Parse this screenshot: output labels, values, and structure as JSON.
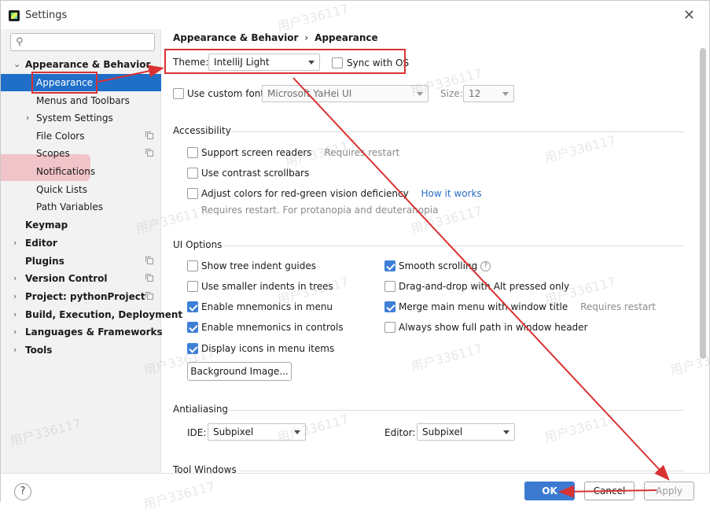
{
  "window": {
    "title": "Settings",
    "close_glyph": "✕"
  },
  "sidebar": {
    "search": {
      "placeholder": "",
      "value": ""
    },
    "items": [
      {
        "label": "Appearance & Behavior",
        "expanded": true
      },
      {
        "label": "Appearance",
        "selected": true
      },
      {
        "label": "Menus and Toolbars"
      },
      {
        "label": "System Settings"
      },
      {
        "label": "File Colors"
      },
      {
        "label": "Scopes"
      },
      {
        "label": "Notifications"
      },
      {
        "label": "Quick Lists"
      },
      {
        "label": "Path Variables"
      },
      {
        "label": "Keymap"
      },
      {
        "label": "Editor"
      },
      {
        "label": "Plugins"
      },
      {
        "label": "Version Control"
      },
      {
        "label": "Project: pythonProject"
      },
      {
        "label": "Build, Execution, Deployment"
      },
      {
        "label": "Languages & Frameworks"
      },
      {
        "label": "Tools"
      }
    ]
  },
  "main": {
    "breadcrumb": {
      "parent": "Appearance & Behavior",
      "separator": "›",
      "current": "Appearance"
    },
    "theme": {
      "label": "Theme:",
      "value": "IntelliJ Light",
      "sync_label": "Sync with OS",
      "sync_checked": false
    },
    "custom_font": {
      "label": "Use custom font:",
      "checked": false,
      "font_value": "Microsoft YaHei UI",
      "size_label": "Size:",
      "size_value": "12"
    },
    "accessibility": {
      "title": "Accessibility",
      "screen_readers": {
        "label": "Support screen readers",
        "hint": "Requires restart",
        "checked": false
      },
      "contrast_scrollbars": {
        "label": "Use contrast scrollbars",
        "checked": false
      },
      "red_green": {
        "label": "Adjust colors for red-green vision deficiency",
        "link": "How it works",
        "hint": "Requires restart. For protanopia and deuteranopia",
        "checked": false
      }
    },
    "ui_options": {
      "title": "UI Options",
      "left": [
        {
          "label": "Show tree indent guides",
          "checked": false
        },
        {
          "label": "Use smaller indents in trees",
          "checked": false
        },
        {
          "label": "Enable mnemonics in menu",
          "checked": true
        },
        {
          "label": "Enable mnemonics in controls",
          "checked": true
        },
        {
          "label": "Display icons in menu items",
          "checked": true
        }
      ],
      "right": [
        {
          "label": "Smooth scrolling",
          "checked": true,
          "help": "?"
        },
        {
          "label": "Drag-and-drop with Alt pressed only",
          "checked": false
        },
        {
          "label": "Merge main menu with window title",
          "checked": true,
          "hint": "Requires restart"
        },
        {
          "label": "Always show full path in window header",
          "checked": false
        }
      ],
      "background_button": "Background Image..."
    },
    "antialiasing": {
      "title": "Antialiasing",
      "ide_label": "IDE:",
      "ide_value": "Subpixel",
      "editor_label": "Editor:",
      "editor_value": "Subpixel"
    },
    "tool_windows": {
      "title": "Tool Windows"
    }
  },
  "footer": {
    "help": "?",
    "ok": "OK",
    "cancel": "Cancel",
    "apply": "Apply"
  },
  "watermark": "用户336117",
  "colors": {
    "accent": "#3c7ad2",
    "selection": "#1f6fc9",
    "annotation_red": "#d93232"
  }
}
